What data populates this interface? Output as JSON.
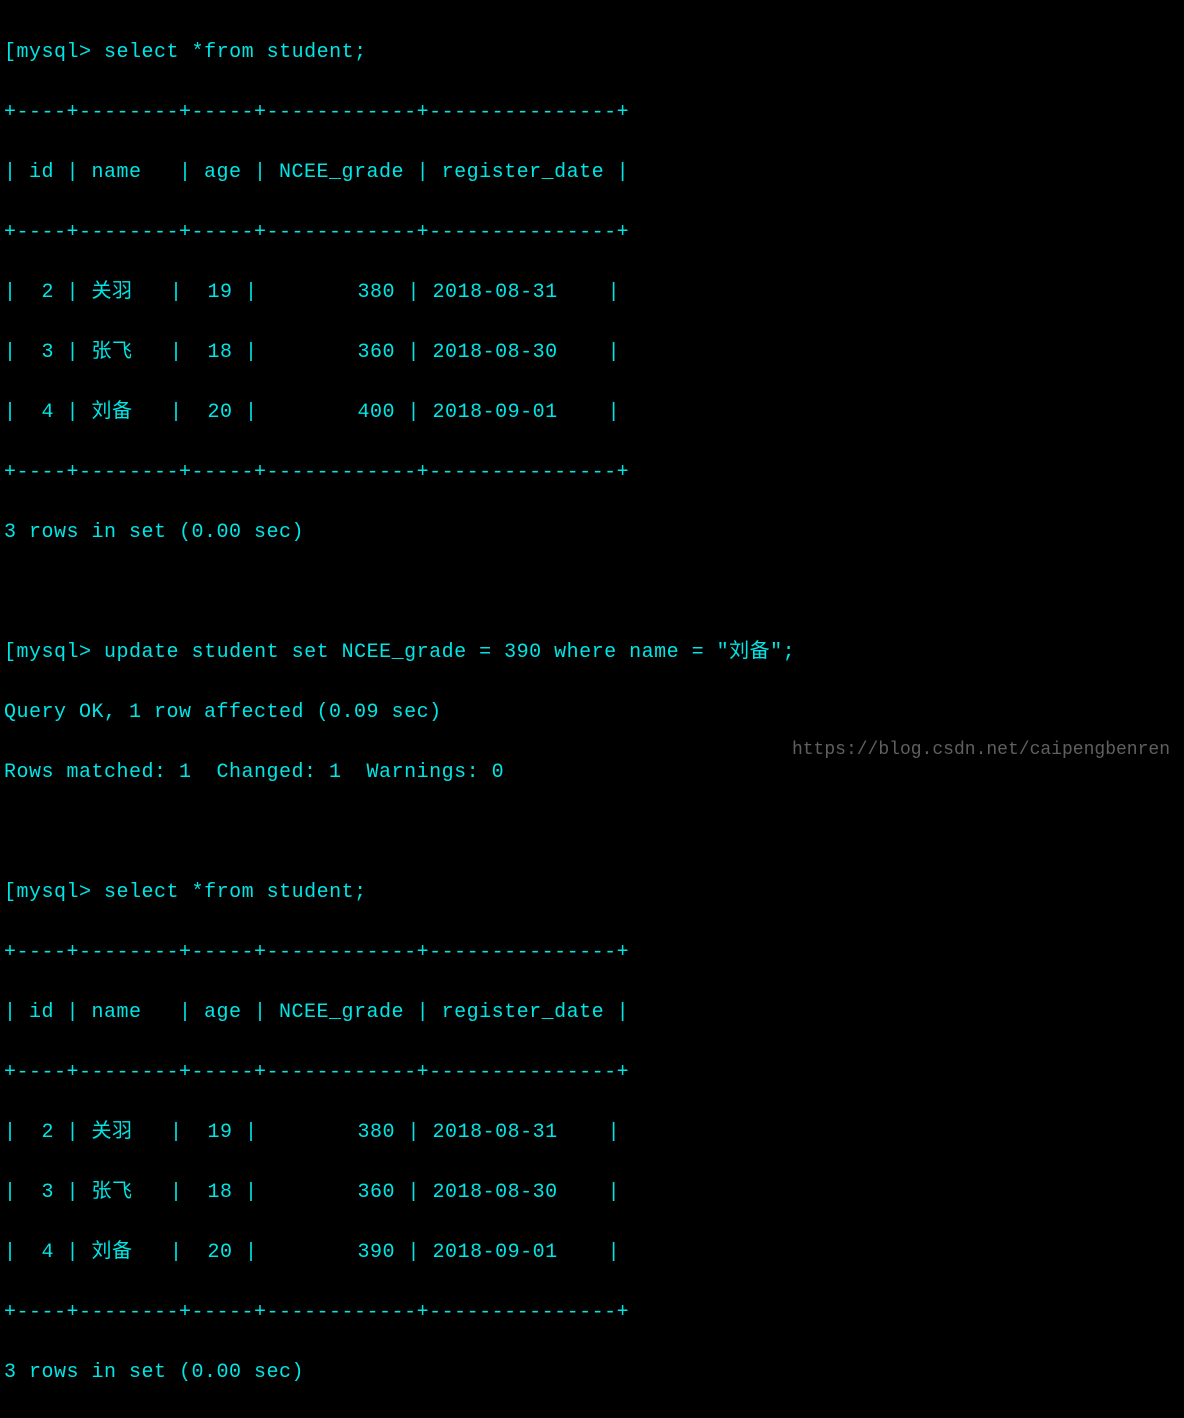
{
  "terminal": {
    "prompt": "mysql>",
    "query1": {
      "command": "select *from student;",
      "border_top": "+----+--------+-----+------------+---------------+",
      "header": "| id | name   | age | NCEE_grade | register_date |",
      "border_mid": "+----+--------+-----+------------+---------------+",
      "rows": [
        "|  2 | 关羽   |  19 |        380 | 2018-08-31    |",
        "|  3 | 张飞   |  18 |        360 | 2018-08-30    |",
        "|  4 | 刘备   |  20 |        400 | 2018-09-01    |"
      ],
      "border_bot": "+----+--------+-----+------------+---------------+",
      "footer": "3 rows in set (0.00 sec)"
    },
    "query2": {
      "command": "update student set NCEE_grade = 390 where name = \"刘备\";",
      "result1": "Query OK, 1 row affected (0.09 sec)",
      "result2": "Rows matched: 1  Changed: 1  Warnings: 0"
    },
    "query3": {
      "command": "select *from student;",
      "border_top": "+----+--------+-----+------------+---------------+",
      "header": "| id | name   | age | NCEE_grade | register_date |",
      "border_mid": "+----+--------+-----+------------+---------------+",
      "rows": [
        "|  2 | 关羽   |  19 |        380 | 2018-08-31    |",
        "|  3 | 张飞   |  18 |        360 | 2018-08-30    |",
        "|  4 | 刘备   |  20 |        390 | 2018-09-01    |"
      ],
      "border_bot": "+----+--------+-----+------------+---------------+",
      "footer": "3 rows in set (0.00 sec)"
    }
  },
  "watermark": "https://blog.csdn.net/caipengbenren"
}
